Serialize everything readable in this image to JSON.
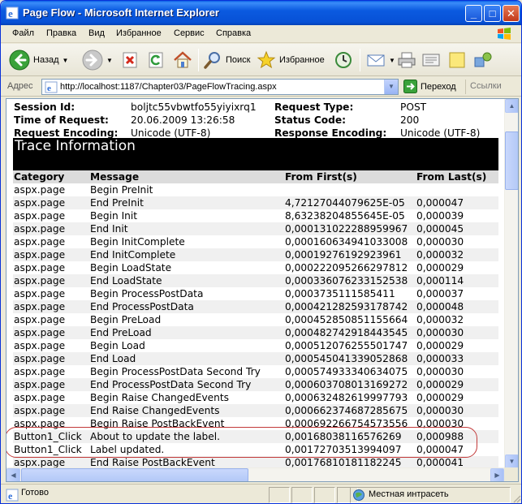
{
  "window": {
    "title": "Page Flow - Microsoft Internet Explorer",
    "minimize": "_",
    "maximize": "□",
    "close": "✕"
  },
  "menu": [
    "Файл",
    "Правка",
    "Вид",
    "Избранное",
    "Сервис",
    "Справка"
  ],
  "toolbar": {
    "back_label": "Назад",
    "search_label": "Поиск",
    "favorites_label": "Избранное"
  },
  "address": {
    "label": "Адрес",
    "url": "http://localhost:1187/Chapter03/PageFlowTracing.aspx",
    "go_label": "Переход",
    "links_label": "Ссылки"
  },
  "request": {
    "session_id_label": "Session Id:",
    "session_id": "boljtc55vbwtfo55yiyixrq1",
    "request_type_label": "Request Type:",
    "request_type": "POST",
    "time_label": "Time of Request:",
    "time": "20.06.2009 13:26:58",
    "status_code_label": "Status Code:",
    "status_code": "200",
    "req_encoding_label": "Request Encoding:",
    "req_encoding": "Unicode (UTF-8)",
    "resp_encoding_label": "Response Encoding:",
    "resp_encoding": "Unicode (UTF-8)"
  },
  "trace": {
    "title": "Trace Information",
    "headers": {
      "category": "Category",
      "message": "Message",
      "from_first": "From First(s)",
      "from_last": "From Last(s)"
    },
    "rows": [
      {
        "category": "aspx.page",
        "message": "Begin PreInit",
        "from_first": "",
        "from_last": ""
      },
      {
        "category": "aspx.page",
        "message": "End PreInit",
        "from_first": "4,72127044079625E-05",
        "from_last": "0,000047"
      },
      {
        "category": "aspx.page",
        "message": "Begin Init",
        "from_first": "8,63238204855645E-05",
        "from_last": "0,000039"
      },
      {
        "category": "aspx.page",
        "message": "End Init",
        "from_first": "0,000131022288959967",
        "from_last": "0,000045"
      },
      {
        "category": "aspx.page",
        "message": "Begin InitComplete",
        "from_first": "0,000160634941033008",
        "from_last": "0,000030"
      },
      {
        "category": "aspx.page",
        "message": "End InitComplete",
        "from_first": "0,00019276192923961",
        "from_last": "0,000032"
      },
      {
        "category": "aspx.page",
        "message": "Begin LoadState",
        "from_first": "0,000222095266297812",
        "from_last": "0,000029"
      },
      {
        "category": "aspx.page",
        "message": "End LoadState",
        "from_first": "0,000336076233152538",
        "from_last": "0,000114"
      },
      {
        "category": "aspx.page",
        "message": "Begin ProcessPostData",
        "from_first": "0,0003735111585411",
        "from_last": "0,000037"
      },
      {
        "category": "aspx.page",
        "message": "End ProcessPostData",
        "from_first": "0,000421282593178742",
        "from_last": "0,000048"
      },
      {
        "category": "aspx.page",
        "message": "Begin PreLoad",
        "from_first": "0,000452850851155664",
        "from_last": "0,000032"
      },
      {
        "category": "aspx.page",
        "message": "End PreLoad",
        "from_first": "0,000482742918443545",
        "from_last": "0,000030"
      },
      {
        "category": "aspx.page",
        "message": "Begin Load",
        "from_first": "0,000512076255501747",
        "from_last": "0,000029"
      },
      {
        "category": "aspx.page",
        "message": "End Load",
        "from_first": "0,000545041339052868",
        "from_last": "0,000033"
      },
      {
        "category": "aspx.page",
        "message": "Begin ProcessPostData Second Try",
        "from_first": "0,000574933340634075",
        "from_last": "0,000030"
      },
      {
        "category": "aspx.page",
        "message": "End ProcessPostData Second Try",
        "from_first": "0,000603708013169272",
        "from_last": "0,000029"
      },
      {
        "category": "aspx.page",
        "message": "Begin Raise ChangedEvents",
        "from_first": "0,000632482619997793",
        "from_last": "0,000029"
      },
      {
        "category": "aspx.page",
        "message": "End Raise ChangedEvents",
        "from_first": "0,000662374687285675",
        "from_last": "0,000030"
      },
      {
        "category": "aspx.page",
        "message": "Begin Raise PostBackEvent",
        "from_first": "0,000692266754573556",
        "from_last": "0,000030"
      },
      {
        "category": "Button1_Click",
        "message": "About to update the label.",
        "from_first": "0,00168038116576269",
        "from_last": "0,000988"
      },
      {
        "category": "Button1_Click",
        "message": "Label updated.",
        "from_first": "0,00172703513994097",
        "from_last": "0,000047"
      },
      {
        "category": "aspx.page",
        "message": "End Raise PostBackEvent",
        "from_first": "0,00176810181182245",
        "from_last": "0,000041"
      }
    ]
  },
  "status": {
    "text": "Готово",
    "zone": "Местная интрасеть"
  },
  "colors": {
    "titlebar": "#0b5ae0",
    "highlight": "#c23a3a",
    "trace_header_bg": "#000000"
  }
}
